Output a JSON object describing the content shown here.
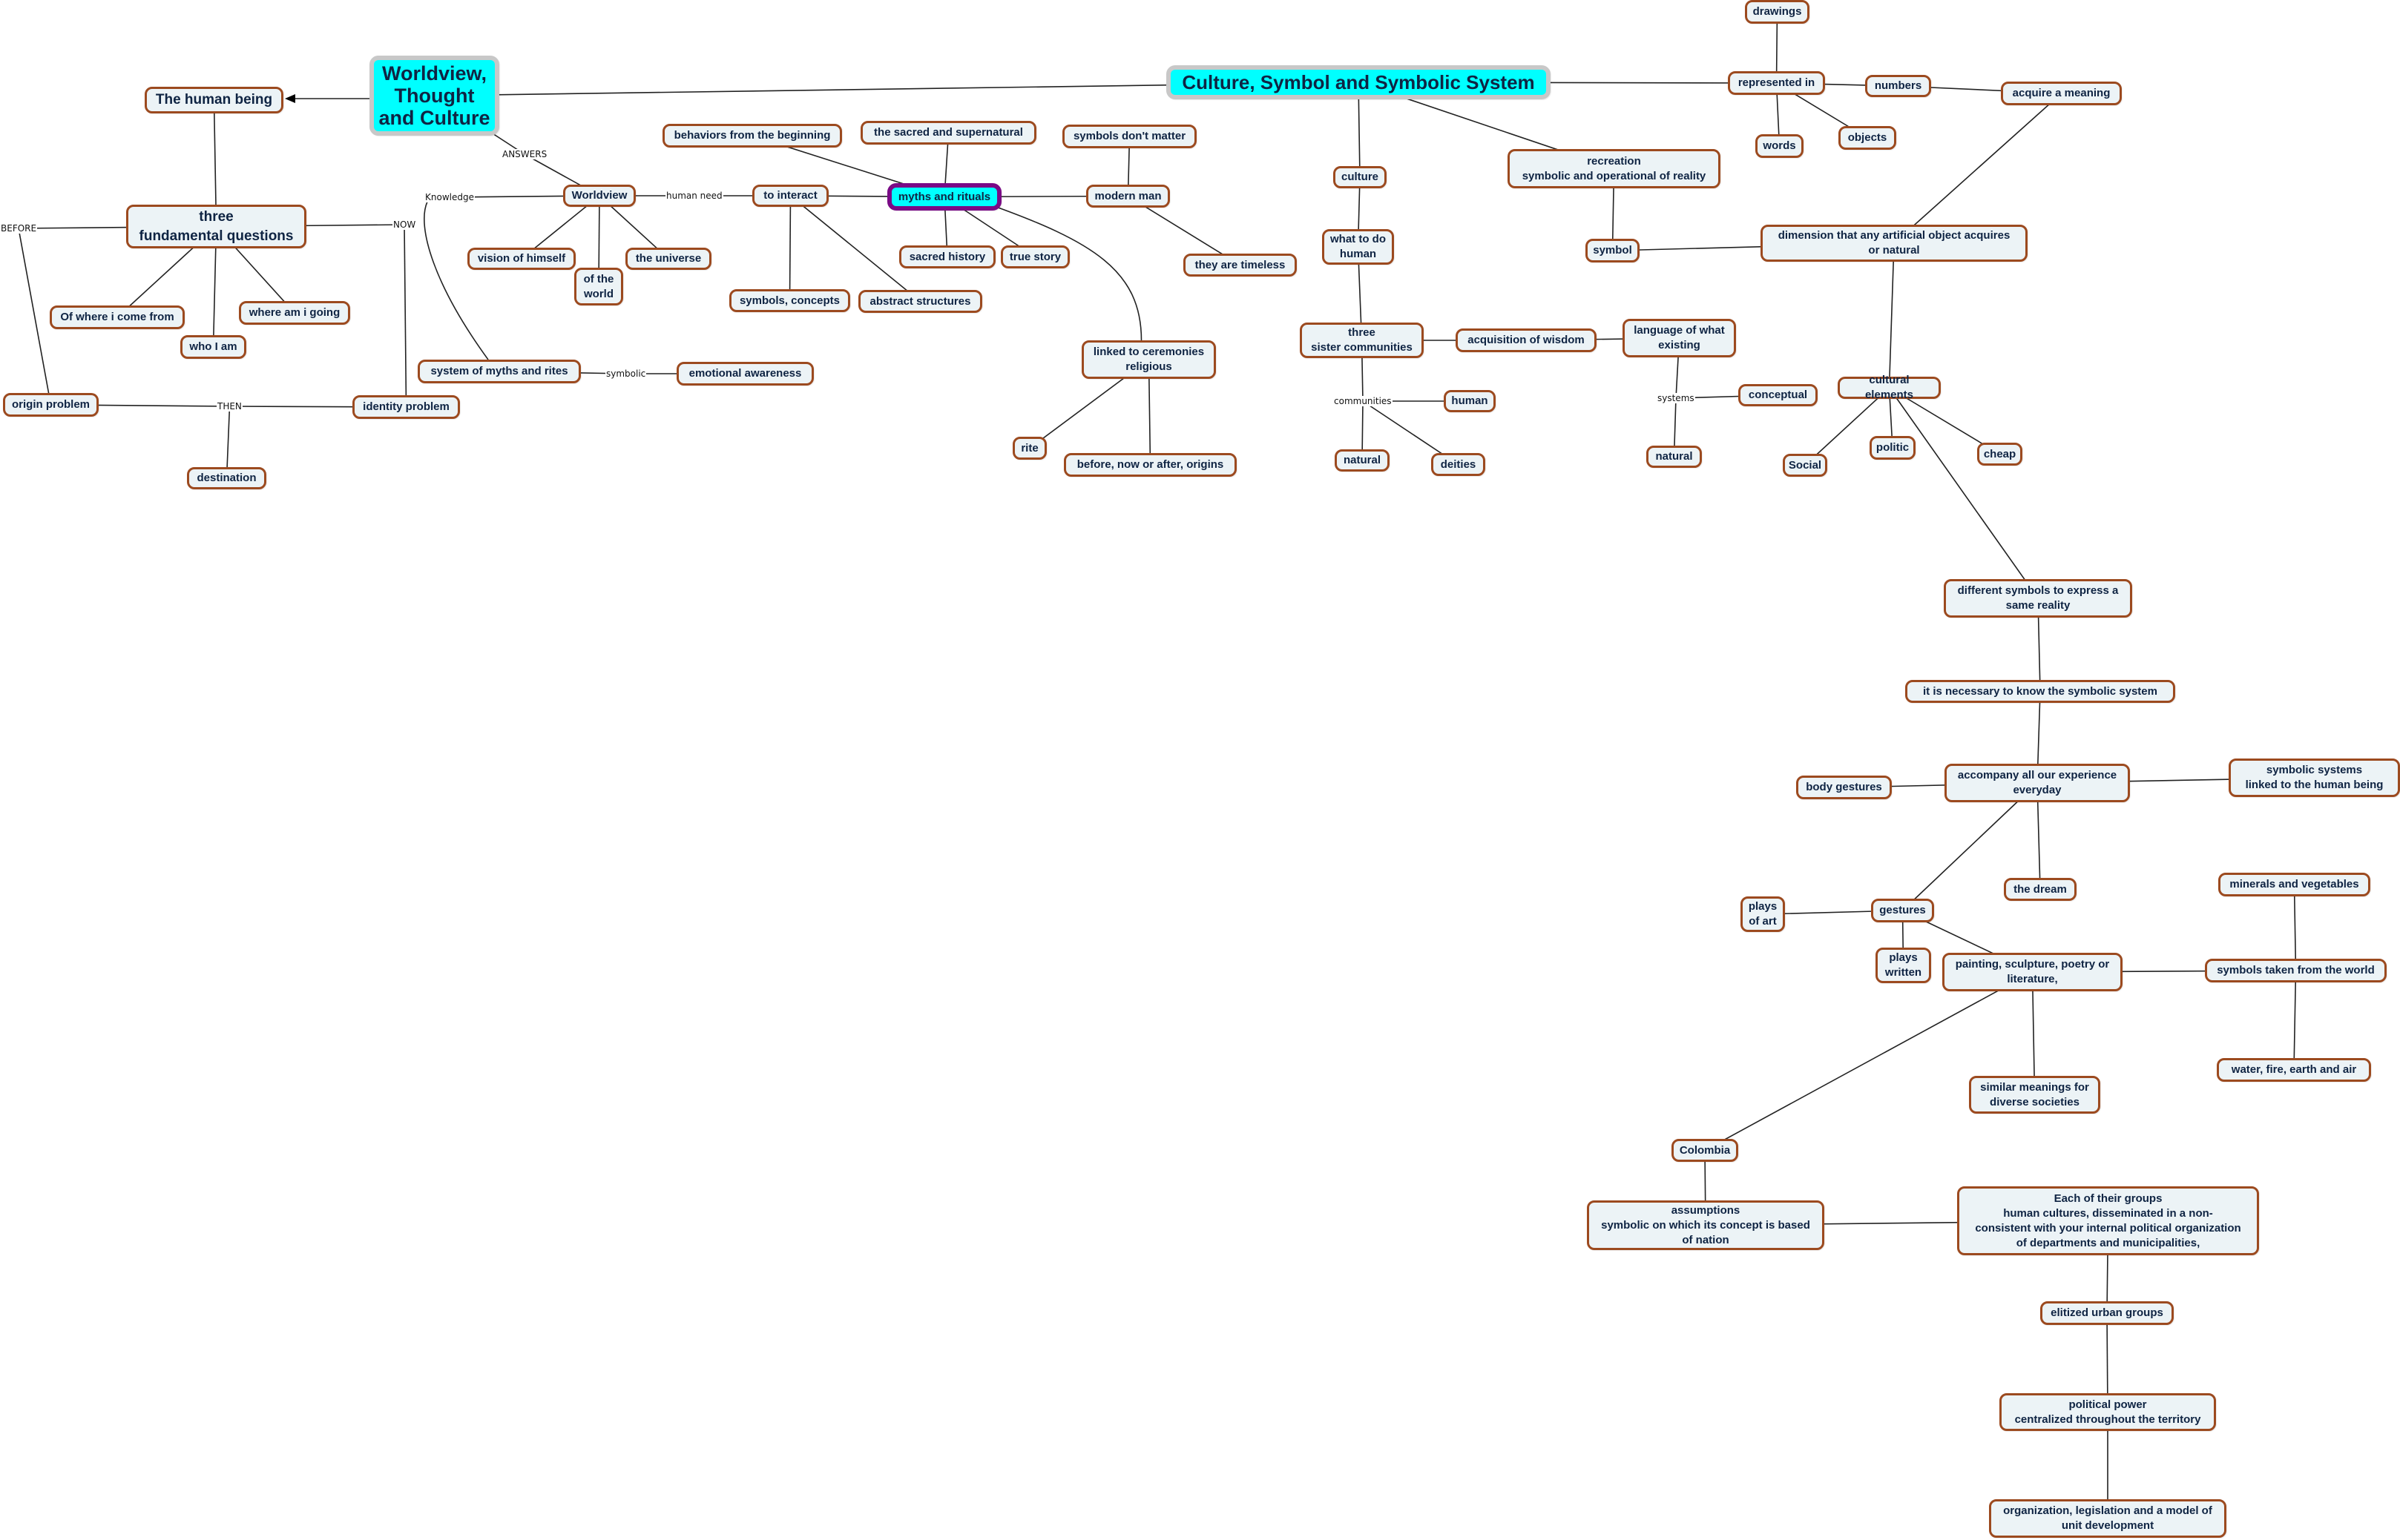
{
  "map_title": "Worldview, Thought and Culture",
  "colors": {
    "root_fill": "#00ffff",
    "root_border": "#c8c8c8",
    "focus_border": "#7a0a86",
    "node_fill": "#ecf3f6",
    "node_border": "#9c4a1f",
    "text": "#0f2443"
  },
  "nodes": {
    "worldview_root": "Worldview,\nThought\nand Culture",
    "culture_root": "Culture, Symbol and Symbolic System",
    "human_being": "The human being",
    "three_questions": "three\nfundamental questions",
    "where_come_from": "Of where i come from",
    "who_i_am": "who I am",
    "where_going": "where am i going",
    "origin_problem": "origin problem",
    "identity_problem": "identity problem",
    "destination": "destination",
    "worldview": "Worldview",
    "vision_himself": "vision of himself",
    "of_the_world": "of the\nworld",
    "the_universe": "the universe",
    "system_myths": "system of myths and rites",
    "emotional_awareness": "emotional awareness",
    "to_interact": "to interact",
    "symbols_concepts": "symbols, concepts",
    "abstract_structures": "abstract structures",
    "behaviors_beginning": "behaviors from the beginning",
    "sacred_supernatural": "the sacred and supernatural",
    "myths_rituals": "myths and rituals",
    "sacred_history": "sacred history",
    "true_story": "true story",
    "symbols_dont_matter": "symbols don't matter",
    "modern_man": "modern man",
    "they_timeless": "they are timeless",
    "linked_ceremonies": "linked to ceremonies\nreligious",
    "rite": "rite",
    "before_now_after": "before, now or after, origins",
    "culture": "culture",
    "what_to_do": "what to do\nhuman",
    "three_sister": "three\nsister communities",
    "acquisition_wisdom": "acquisition of wisdom",
    "language_existing": "language of what\nexisting",
    "human": "human",
    "natural_1": "natural",
    "deities": "deities",
    "conceptual": "conceptual",
    "natural_2": "natural",
    "recreation": "recreation\nsymbolic and operational of reality",
    "symbol": "symbol",
    "drawings": "drawings",
    "represented_in": "represented in",
    "numbers": "numbers",
    "words": "words",
    "objects": "objects",
    "acquire_meaning": "acquire a meaning",
    "dimension": "dimension that any artificial object acquires\nor natural",
    "cultural_elements": "cultural elements",
    "social": "Social",
    "politic": "politic",
    "cheap": "cheap",
    "different_symbols": "different symbols to express a\nsame reality",
    "necessary_know": "it is necessary to know the symbolic system",
    "accompany": "accompany all our experience\neveryday",
    "body_gestures": "body gestures",
    "symbolic_systems_linked": "symbolic systems\nlinked to the human being",
    "the_dream": "the dream",
    "gestures": "gestures",
    "plays_art": "plays\nof art",
    "plays_written": "plays\nwritten",
    "painting": "painting, sculpture, poetry or\nliterature,",
    "minerals": "minerals and vegetables",
    "symbols_taken": "symbols taken from the world",
    "water_fire": "water, fire, earth and air",
    "similar_meanings": "similar meanings for\ndiverse societies",
    "colombia": "Colombia",
    "assumptions": "assumptions\nsymbolic on which its concept is based\nof nation",
    "each_groups": "Each of their groups\nhuman cultures, disseminated in a non-\nconsistent with your internal political organization\nof departments and municipalities,",
    "elitized": "elitized urban groups",
    "political_power": "political power\ncentralized throughout the territory",
    "organization": "organization, legislation and a model of\nunit development"
  },
  "link_labels": {
    "answers": "ANSWERS",
    "knowledge": "Knowledge",
    "human_need": "human need",
    "before": "BEFORE",
    "now": "NOW",
    "then": "THEN",
    "symbolic": "symbolic",
    "communities": "communities",
    "systems": "systems"
  }
}
